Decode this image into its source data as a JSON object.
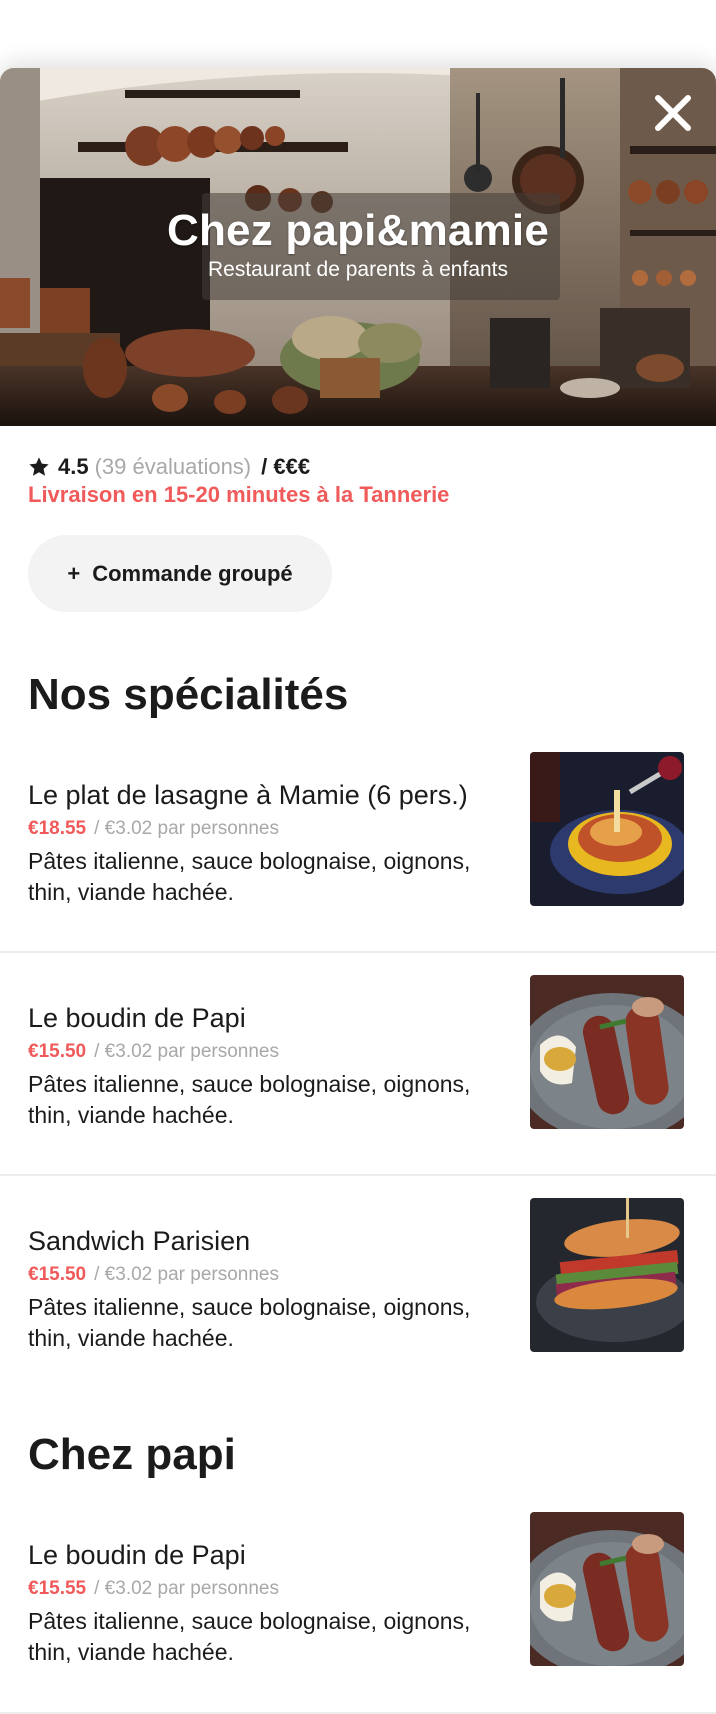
{
  "restaurant": {
    "name": "Chez papi&mamie",
    "tagline": "Restaurant de parents à enfants",
    "rating": "4.5",
    "reviews": "(39 évaluations)",
    "price_level": "/ €€€",
    "delivery": "Livraison en 15-20 minutes à la Tannerie"
  },
  "actions": {
    "group_order_label": "Commande groupé",
    "group_order_icon": "+"
  },
  "sections": [
    {
      "title": "Nos spécialités",
      "items": [
        {
          "name": "Le plat de lasagne à Mamie (6 pers.)",
          "price": "€18.55",
          "per_person": "/ €3.02 par personnes",
          "description": "Pâtes italienne, sauce bolognaise, oignons, thin, viande hachée.",
          "image": "lasagna-photo"
        },
        {
          "name": "Le boudin de Papi",
          "price": "€15.50",
          "per_person": "/ €3.02 par personnes",
          "description": "Pâtes italienne, sauce bolognaise, oignons, thin, viande hachée.",
          "image": "sausage-photo"
        },
        {
          "name": "Sandwich Parisien",
          "price": "€15.50",
          "per_person": "/ €3.02 par personnes",
          "description": "Pâtes italienne, sauce bolognaise, oignons, thin, viande hachée.",
          "image": "sandwich-photo"
        }
      ]
    },
    {
      "title": "Chez papi",
      "items": [
        {
          "name": "Le boudin de Papi",
          "price": "€15.55",
          "per_person": "/ €3.02 par personnes",
          "description": "Pâtes italienne, sauce bolognaise, oignons, thin, viande hachée.",
          "image": "sausage-photo"
        }
      ]
    }
  ],
  "colors": {
    "accent": "#f05a5a",
    "muted": "#a8a8a8",
    "text": "#1b1b1b",
    "button_bg": "#f3f3f3"
  },
  "icons": {
    "close": "close-icon",
    "star": "star-icon"
  }
}
